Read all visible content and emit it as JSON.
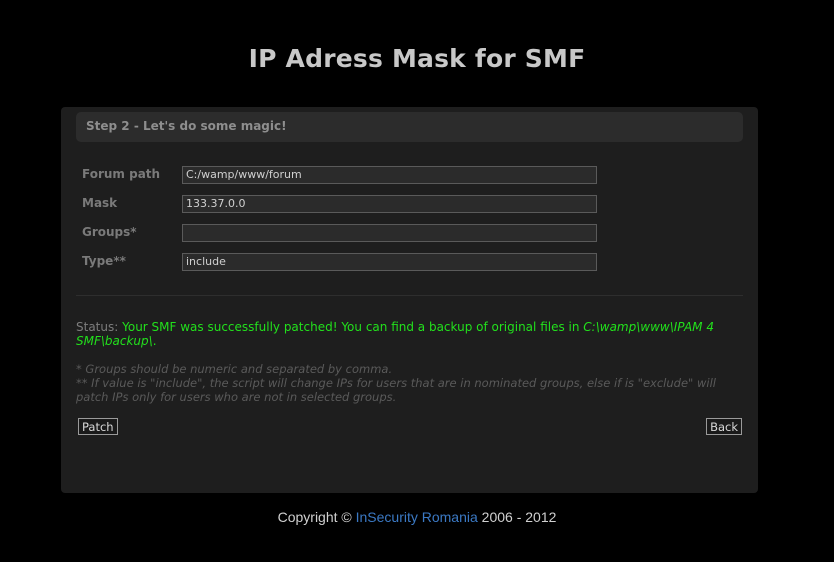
{
  "page": {
    "title": "IP Adress Mask for SMF"
  },
  "step": {
    "heading": "Step 2 - Let's do some magic!"
  },
  "form": {
    "forum_path": {
      "label": "Forum path",
      "value": "C:/wamp/www/forum"
    },
    "mask": {
      "label": "Mask",
      "value": "133.37.0.0"
    },
    "groups": {
      "label": "Groups*",
      "value": ""
    },
    "type": {
      "label": "Type**",
      "value": "include"
    }
  },
  "status": {
    "prefix": "Status:",
    "message": "Your SMF was successfully patched! You can find a backup of original files in",
    "backup_path": "C:\\wamp\\www\\IPAM 4 SMF\\backup\\",
    "suffix": "."
  },
  "notes": {
    "groups_note": "* Groups should be numeric and separated by comma.",
    "type_note": "** If value is \"include\", the script will change IPs for users that are in nominated groups, else if is \"exclude\" will patch IPs only for users who are not in selected groups."
  },
  "buttons": {
    "patch": "Patch",
    "back": "Back"
  },
  "footer": {
    "copyright": "Copyright ©",
    "link_text": "InSecurity Romania",
    "years": "2006 - 2012"
  },
  "colors": {
    "background": "#000000",
    "panel": "#1e1e1e",
    "success": "#22e01c",
    "link": "#3b79c4"
  }
}
